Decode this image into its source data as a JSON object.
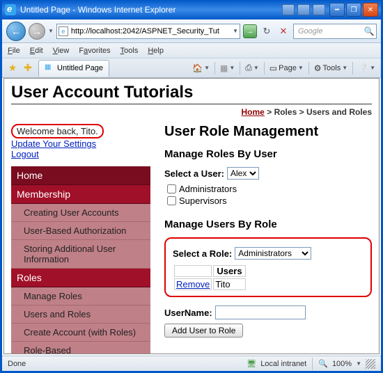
{
  "window": {
    "title": "Untitled Page - Windows Internet Explorer",
    "url": "http://localhost:2042/ASPNET_Security_Tut",
    "search_placeholder": "Google"
  },
  "menu": [
    "File",
    "Edit",
    "View",
    "Favorites",
    "Tools",
    "Help"
  ],
  "tab": {
    "title": "Untitled Page"
  },
  "toolbar": {
    "home": "",
    "feeds": "",
    "print": "",
    "page": "Page",
    "tools": "Tools"
  },
  "page": {
    "h1": "User Account Tutorials",
    "breadcrumb": {
      "home": "Home",
      "sep": ">",
      "l1": "Roles",
      "l2": "Users and Roles"
    },
    "welcome": "Welcome back, Tito.",
    "links": {
      "settings": "Update Your Settings",
      "logout": "Logout"
    },
    "nav": [
      {
        "t": "Home",
        "lvl": 1,
        "sel": false
      },
      {
        "t": "Membership",
        "lvl": 1,
        "sel": true
      },
      {
        "t": "Creating User Accounts",
        "lvl": 2
      },
      {
        "t": "User-Based Authorization",
        "lvl": 2
      },
      {
        "t": "Storing Additional User Information",
        "lvl": 2
      },
      {
        "t": "Roles",
        "lvl": 1,
        "sel": true
      },
      {
        "t": "Manage Roles",
        "lvl": 2
      },
      {
        "t": "Users and Roles",
        "lvl": 2
      },
      {
        "t": "Create Account (with Roles)",
        "lvl": 2
      },
      {
        "t": "Role-Based",
        "lvl": 2
      }
    ],
    "main": {
      "h2": "User Role Management",
      "byUser": {
        "h3": "Manage Roles By User",
        "label": "Select a User:",
        "selected": "Alex",
        "checks": [
          "Administrators",
          "Supervisors"
        ]
      },
      "byRole": {
        "h3": "Manage Users By Role",
        "label": "Select a Role:",
        "selected": "Administrators",
        "table": {
          "col1": "",
          "col2": "Users",
          "removeText": "Remove",
          "user": "Tito"
        },
        "userLabel": "UserName:",
        "addBtn": "Add User to Role"
      }
    }
  },
  "status": {
    "left": "Done",
    "zone": "Local intranet",
    "zoom": "100%"
  }
}
